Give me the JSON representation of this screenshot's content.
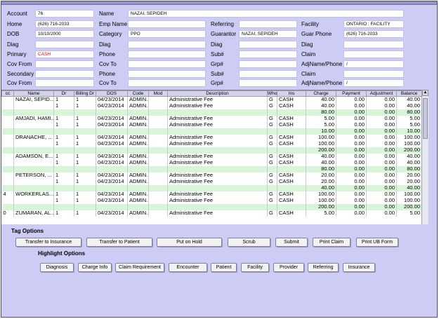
{
  "patient": {
    "labels": {
      "account": "Account",
      "name": "Name",
      "home": "Home",
      "emp_name": "Emp Name",
      "referring": "Referring",
      "facility": "Facility",
      "dob": "DOB",
      "category": "Category",
      "guarantor": "Guarantor",
      "guar_phone": "Guar Phone",
      "diag1": "Diag",
      "diag2": "Diag",
      "diag3": "Diag",
      "diag4": "Diag",
      "primary": "Primary",
      "phone1": "Phone",
      "sub1": "Sub#",
      "claim1": "Claim",
      "cov_from1": "Cov From",
      "cov_to1": "Cov To",
      "grp1": "Grp#",
      "adj1": "AdjName/Phone",
      "secondary": "Secondary",
      "phone2": "Phone",
      "sub2": "Sub#",
      "claim2": "Claim",
      "cov_from2": "Cov From",
      "cov_to2": "Cov To",
      "grp2": "Grp#",
      "adj2": "AdjName/Phone"
    },
    "account": "76",
    "name": "NAZAI, SEPIDEH",
    "home": "(626) 716-2033",
    "emp_name": "",
    "referring": "",
    "facility": "ONTARIO : FACILITY",
    "dob": "10/10/2000",
    "category": "PPO",
    "guarantor": "NAZAI, SEPIDEH",
    "guar_phone": "(626) 716-2033",
    "primary": "CASH",
    "adj1": "/",
    "adj2": "/"
  },
  "grid": {
    "headers": [
      "cc",
      "Name",
      "Dr",
      "Billing Dr",
      "DOS",
      "Code",
      "Mod",
      "Description",
      "Who",
      "Ins",
      "Charge",
      "Payment",
      "Adjustment",
      "Balance"
    ],
    "rows": [
      {
        "t": "odd",
        "c": [
          "",
          "NAZAI, SEPID...",
          "1",
          "1",
          "04/23/2014",
          "ADMIN...",
          "",
          "Administrative Fee",
          "G",
          "CASH",
          "40.00",
          "0.00",
          "0.00",
          "40.00"
        ]
      },
      {
        "t": "even",
        "c": [
          "",
          "",
          "1",
          "1",
          "04/23/2014",
          "ADMIN...",
          "",
          "Administrative Fee",
          "G",
          "CASH",
          "40.00",
          "0.00",
          "0.00",
          "40.00"
        ]
      },
      {
        "t": "sub",
        "c": [
          "",
          "",
          "",
          "",
          "",
          "",
          "",
          "",
          "",
          "",
          "80.00",
          "0.00",
          "0.00",
          "80.00"
        ]
      },
      {
        "t": "odd",
        "c": [
          "",
          "AMJADI, HAMI...",
          "1",
          "1",
          "04/23/2014",
          "ADMIN...",
          "",
          "Administrative Fee",
          "G",
          "CASH",
          "5.00",
          "0.00",
          "0.00",
          "5.00"
        ]
      },
      {
        "t": "even",
        "c": [
          "",
          "",
          "1",
          "1",
          "04/23/2014",
          "ADMIN...",
          "",
          "Administrative Fee",
          "G",
          "CASH",
          "5.00",
          "0.00",
          "0.00",
          "5.00"
        ]
      },
      {
        "t": "sub",
        "c": [
          "",
          "",
          "",
          "",
          "",
          "",
          "",
          "",
          "",
          "",
          "10.00",
          "0.00",
          "0.00",
          "10.00"
        ]
      },
      {
        "t": "odd",
        "c": [
          "",
          "DRANACHE, ...",
          "1",
          "1",
          "04/23/2014",
          "ADMIN...",
          "",
          "Administrative Fee",
          "G",
          "CASH",
          "100.00",
          "0.00",
          "0.00",
          "100.00"
        ]
      },
      {
        "t": "even",
        "c": [
          "",
          "",
          "1",
          "1",
          "04/23/2014",
          "ADMIN...",
          "",
          "Administrative Fee",
          "G",
          "CASH",
          "100.00",
          "0.00",
          "0.00",
          "100.00"
        ]
      },
      {
        "t": "sub",
        "c": [
          "",
          "",
          "",
          "",
          "",
          "",
          "",
          "",
          "",
          "",
          "200.00",
          "0.00",
          "0.00",
          "200.00"
        ]
      },
      {
        "t": "odd",
        "c": [
          "",
          "ADAMSON, E...",
          "1",
          "1",
          "04/23/2014",
          "ADMIN...",
          "",
          "Administrative Fee",
          "G",
          "CASH",
          "40.00",
          "0.00",
          "0.00",
          "40.00"
        ]
      },
      {
        "t": "even",
        "c": [
          "",
          "",
          "1",
          "1",
          "04/23/2014",
          "ADMIN...",
          "",
          "Administrative Fee",
          "G",
          "CASH",
          "40.00",
          "0.00",
          "0.00",
          "40.00"
        ]
      },
      {
        "t": "sub",
        "c": [
          "",
          "",
          "",
          "",
          "",
          "",
          "",
          "",
          "",
          "",
          "80.00",
          "0.00",
          "0.00",
          "80.00"
        ]
      },
      {
        "t": "odd",
        "c": [
          "",
          "PETERSON, ...",
          "1",
          "1",
          "04/23/2014",
          "ADMIN...",
          "",
          "Administrative Fee",
          "G",
          "CASH",
          "20.00",
          "0.00",
          "0.00",
          "20.00"
        ]
      },
      {
        "t": "even",
        "c": [
          "",
          "",
          "1",
          "1",
          "04/23/2014",
          "ADMIN...",
          "",
          "Administrative Fee",
          "G",
          "CASH",
          "20.00",
          "0.00",
          "0.00",
          "20.00"
        ]
      },
      {
        "t": "sub",
        "c": [
          "",
          "",
          "",
          "",
          "",
          "",
          "",
          "",
          "",
          "",
          "40.00",
          "0.00",
          "0.00",
          "40.00"
        ]
      },
      {
        "t": "odd",
        "c": [
          "4",
          "WORKERLAS...",
          "1",
          "1",
          "04/23/2014",
          "ADMIN...",
          "",
          "Administrative Fee",
          "G",
          "CASH",
          "100.00",
          "0.00",
          "0.00",
          "100.00"
        ]
      },
      {
        "t": "even",
        "c": [
          "",
          "",
          "1",
          "1",
          "04/23/2014",
          "ADMIN...",
          "",
          "Administrative Fee",
          "G",
          "CASH",
          "100.00",
          "0.00",
          "0.00",
          "100.00"
        ]
      },
      {
        "t": "sub",
        "c": [
          "",
          "",
          "",
          "",
          "",
          "",
          "",
          "",
          "",
          "",
          "200.00",
          "0.00",
          "0.00",
          "200.00"
        ]
      },
      {
        "t": "odd",
        "c": [
          "0",
          "ZUMARAN, AL...",
          "1",
          "1",
          "04/23/2014",
          "ADMIN...",
          "",
          "Administrative Fee",
          "G",
          "CASH",
          "5.00",
          "0.00",
          "0.00",
          "5.00"
        ]
      }
    ]
  },
  "tag_options": {
    "title": "Tag Options",
    "buttons": [
      "Transfer to Insurance",
      "Transfer to Patient",
      "Put on Hold",
      "Scrub",
      "Submit",
      "Print Claim",
      "Print UB Form"
    ]
  },
  "highlight_options": {
    "title": "Highlight Options",
    "buttons": [
      "Diagnosis",
      "Charge Info",
      "Claim Requirement",
      "Encounter",
      "Patient",
      "Facility",
      "Provider",
      "Referring",
      "Insurance"
    ]
  }
}
